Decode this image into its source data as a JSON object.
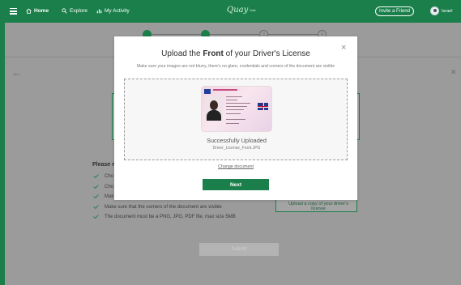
{
  "nav": {
    "home": "Home",
    "explore": "Explore",
    "activity": "My Activity",
    "logo": "Quay",
    "logo_sub": "Note",
    "invite": "Invite a Friend",
    "username": "Israel"
  },
  "steps": [
    "1",
    "2",
    "3",
    "4"
  ],
  "page": {
    "card_text": "Upload a copy of your driver's license",
    "requirements_title": "Please m",
    "requirements": [
      "Cho",
      "Cho",
      "Mak",
      "Make sure that the corners of the document are visible",
      "The document must be a PNG, JPG, PDF file, max size 5MB"
    ],
    "submit": "Submit"
  },
  "modal": {
    "title_pre": "Upload the ",
    "title_bold": "Front",
    "title_post": " of your Driver's License",
    "subtitle": "Make sure your images are not blurry, there's no glare, credentials and corners of the document are visible",
    "status": "Successfully Uploaded",
    "file_name": "Driver_License_Front.JPG",
    "change_link": "Change document",
    "next": "Next",
    "close": "×"
  },
  "colors": {
    "brand_green": "#1a7f4a",
    "overlay_gray": "#9b9b9b"
  }
}
